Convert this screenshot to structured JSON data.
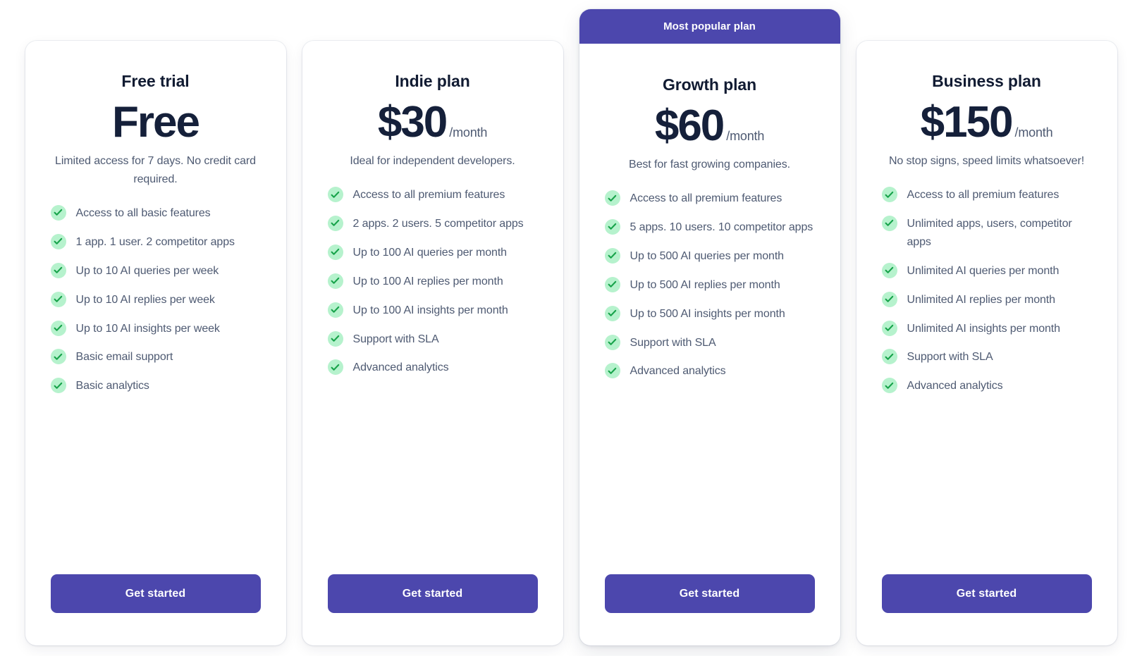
{
  "colors": {
    "accent": "#4c47ad",
    "check_bg": "#b6f2cd",
    "check_mark": "#17a34a",
    "title": "#111b32",
    "price": "#15203a",
    "body_text": "#4e5a72",
    "page_bg": "#ffffff"
  },
  "plans": [
    {
      "name": "Free trial",
      "price": "Free",
      "period": "",
      "tagline": "Limited access for 7 days. No credit card required.",
      "badge": "",
      "featured": false,
      "features": [
        "Access to all basic features",
        "1 app. 1 user. 2 competitor apps",
        "Up to 10 AI queries per week",
        "Up to 10 AI replies per week",
        "Up to 10 AI insights per week",
        "Basic email support",
        "Basic analytics"
      ],
      "cta": "Get started"
    },
    {
      "name": "Indie plan",
      "price": "$30",
      "period": "/month",
      "tagline": "Ideal for independent developers.",
      "badge": "",
      "featured": false,
      "features": [
        "Access to all premium features",
        "2 apps. 2 users. 5 competitor apps",
        "Up to 100 AI queries per month",
        "Up to 100 AI replies per month",
        "Up to 100 AI insights per month",
        "Support with SLA",
        "Advanced analytics"
      ],
      "cta": "Get started"
    },
    {
      "name": "Growth plan",
      "price": "$60",
      "period": "/month",
      "tagline": "Best for fast growing companies.",
      "badge": "Most popular plan",
      "featured": true,
      "features": [
        "Access to all premium features",
        "5 apps. 10 users. 10 competitor apps",
        "Up to 500 AI queries per month",
        "Up to 500 AI replies per month",
        "Up to 500 AI insights per month",
        "Support with SLA",
        "Advanced analytics"
      ],
      "cta": "Get started"
    },
    {
      "name": "Business plan",
      "price": "$150",
      "period": "/month",
      "tagline": "No stop signs, speed limits whatsoever!",
      "badge": "",
      "featured": false,
      "features": [
        "Access to all premium features",
        "Unlimited apps, users, competitor apps",
        "Unlimited AI queries per month",
        "Unlimited AI replies per month",
        "Unlimited AI insights per month",
        "Support with SLA",
        "Advanced analytics"
      ],
      "cta": "Get started"
    }
  ]
}
